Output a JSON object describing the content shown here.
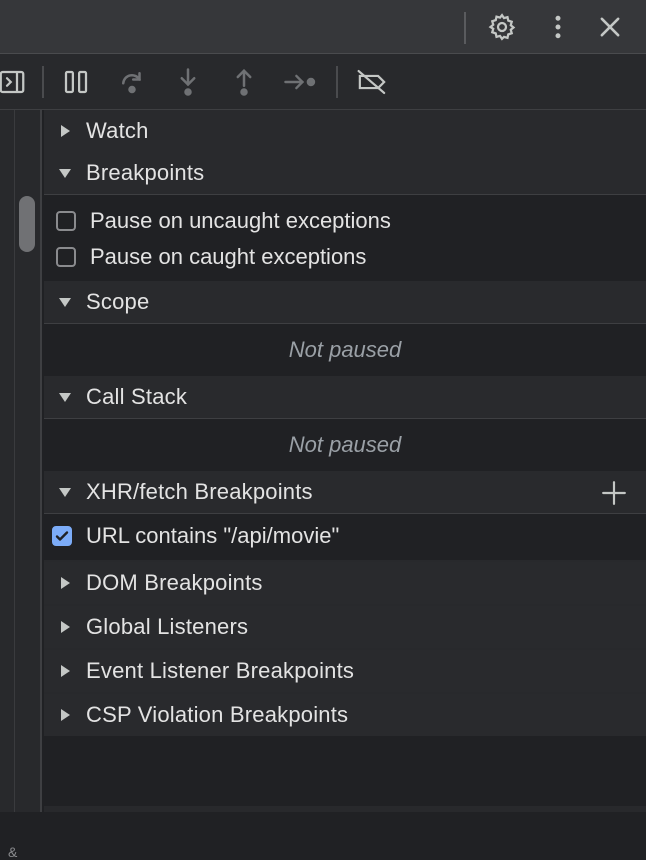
{
  "topbar": {
    "icons": [
      "gear-icon",
      "more-vertical-icon",
      "close-icon"
    ]
  },
  "toolbar": {
    "icons": [
      "toggle-sidebar-icon",
      "pause-icon",
      "step-over-icon",
      "step-into-icon",
      "step-out-icon",
      "step-icon",
      "deactivate-breakpoints-icon"
    ]
  },
  "sections": {
    "watch": "Watch",
    "breakpoints": "Breakpoints",
    "scope": "Scope",
    "call_stack": "Call Stack",
    "xhr": "XHR/fetch Breakpoints",
    "dom": "DOM Breakpoints",
    "global": "Global Listeners",
    "event_listener": "Event Listener Breakpoints",
    "csp": "CSP Violation Breakpoints"
  },
  "breakpoints_options": {
    "uncaught": "Pause on uncaught exceptions",
    "caught": "Pause on caught exceptions"
  },
  "scope_status": "Not paused",
  "call_stack_status": "Not paused",
  "xhr_items": {
    "item0": "URL contains \"/api/movie\""
  },
  "left_tick": "&",
  "colors": {
    "accent": "#7cacf8",
    "panel": "#28292c",
    "content": "#202124",
    "topbar": "#36373a"
  }
}
